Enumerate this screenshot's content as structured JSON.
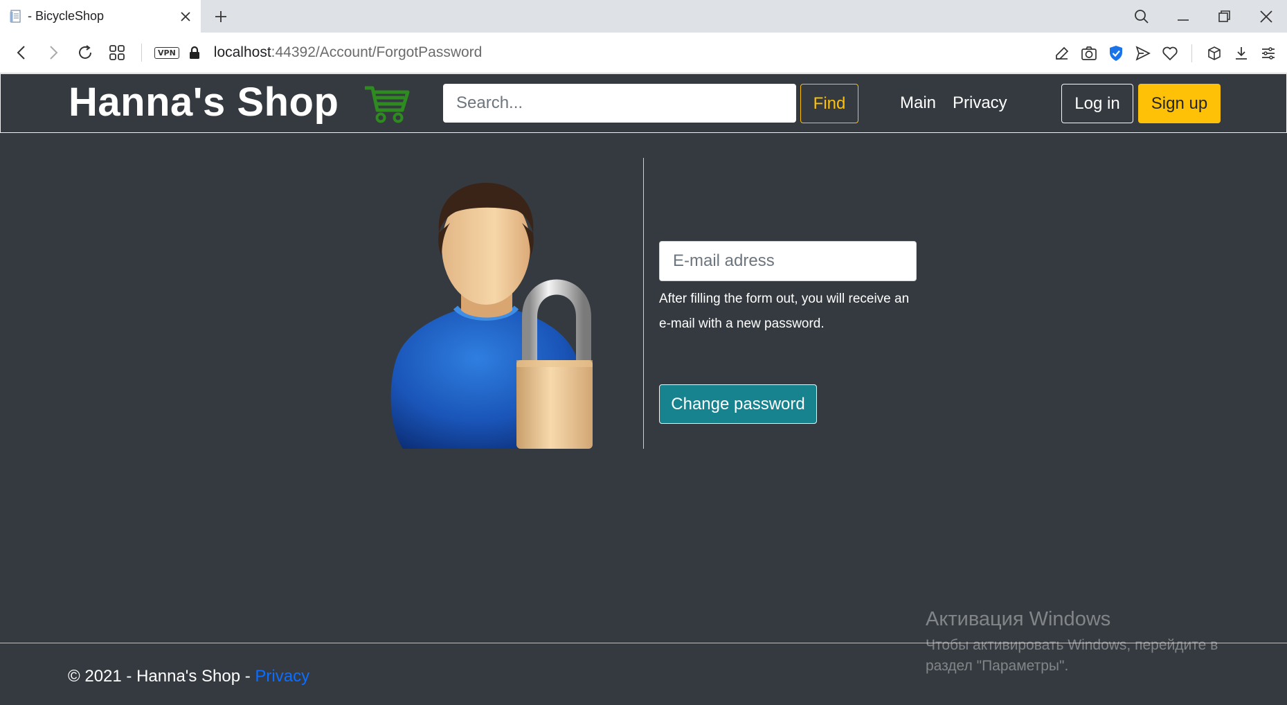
{
  "browser": {
    "tab_title": "- BicycleShop",
    "url_host": "localhost",
    "url_path": ":44392/Account/ForgotPassword",
    "vpn_label": "VPN"
  },
  "header": {
    "brand": "Hanna's Shop",
    "search_placeholder": "Search...",
    "find_label": "Find",
    "nav_main": "Main",
    "nav_privacy": "Privacy",
    "login_label": "Log in",
    "signup_label": "Sign up"
  },
  "form": {
    "email_placeholder": "E-mail adress",
    "help_text": "After filling the form out, you will receive an e-mail with a new password.",
    "submit_label": "Change password"
  },
  "footer": {
    "copyright": "© 2021 - Hanna's Shop - ",
    "privacy_link": "Privacy"
  },
  "watermark": {
    "title": "Активация Windows",
    "subtitle": "Чтобы активировать Windows, перейдите в раздел \"Параметры\"."
  },
  "colors": {
    "page_bg": "#343a40",
    "accent_yellow": "#ffc107",
    "button_teal": "#17838f",
    "cart_green": "#2e8b1f",
    "link_blue": "#0d6efd"
  },
  "icons": [
    "page-icon",
    "close-icon",
    "plus-icon",
    "search-icon",
    "minimize-icon",
    "restore-icon",
    "window-close-icon",
    "back-icon",
    "forward-icon",
    "reload-icon",
    "grid-icon",
    "lock-icon",
    "pen-icon",
    "camera-icon",
    "shield-icon",
    "send-icon",
    "heart-icon",
    "cube-icon",
    "download-icon",
    "menu-icon",
    "cart-icon"
  ]
}
